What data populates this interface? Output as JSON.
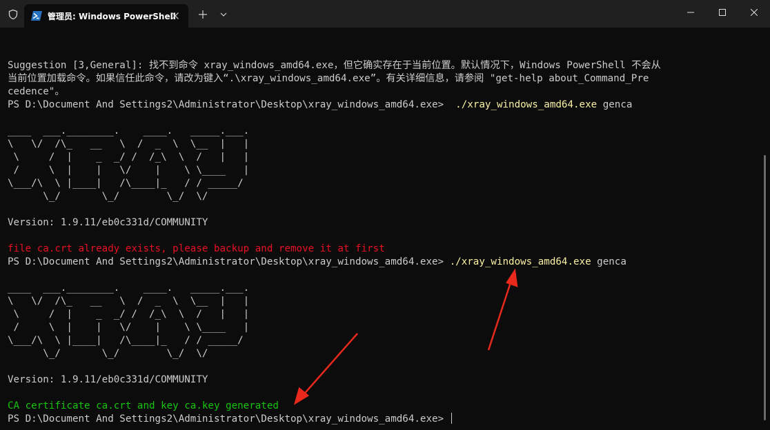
{
  "titlebar": {
    "tab_title": "管理员: Windows PowerShell"
  },
  "icons": {
    "shield": "shield-icon",
    "powershell": "powershell-icon",
    "close_tab": "close-icon",
    "new_tab": "plus-icon",
    "dropdown": "chevron-down-icon",
    "minimize": "minimize-icon",
    "maximize": "maximize-icon",
    "close_window": "close-icon"
  },
  "colors": {
    "error": "#e81123",
    "success": "#16c60c",
    "command": "#f9f1a5",
    "annotation_arrow": "#e8291c"
  },
  "terminal": {
    "suggestion_line_1": "Suggestion [3,General]: 找不到命令 xray_windows_amd64.exe，但它确实存在于当前位置。默认情况下，Windows PowerShell 不会从",
    "suggestion_line_2": "当前位置加载命令。如果信任此命令，请改为键入“.\\xray_windows_amd64.exe”。有关详细信息，请参阅 \"get-help about_Command_Pre",
    "suggestion_line_3": "cedence\"。",
    "prompt": "PS D:\\Document And Settings2\\Administrator\\Desktop\\xray_windows_amd64.exe>",
    "command_1": "./xray_windows_amd64.exe",
    "command_1_args": " genca",
    "command_2": "./xray_windows_amd64.exe",
    "command_2_args": " genca",
    "banner": [
      "____  ___.________.    ____.   _____.___.",
      "\\   \\/  /\\_   __   \\  /  _  \\  \\__  |   |",
      " \\     /  |    _  _/ /  /_\\  \\  /   |   |",
      " /     \\  |    |   \\/    |    \\ \\____   |",
      "\\___/\\  \\ |____|   /\\____|_   / / _____/",
      "      \\_/       \\_/        \\_/  \\/"
    ],
    "version": "Version: 1.9.11/eb0c331d/COMMUNITY",
    "error_message": "file ca.crt already exists, please backup and remove it at first",
    "success_message": "CA certificate ca.crt and key ca.key generated"
  }
}
